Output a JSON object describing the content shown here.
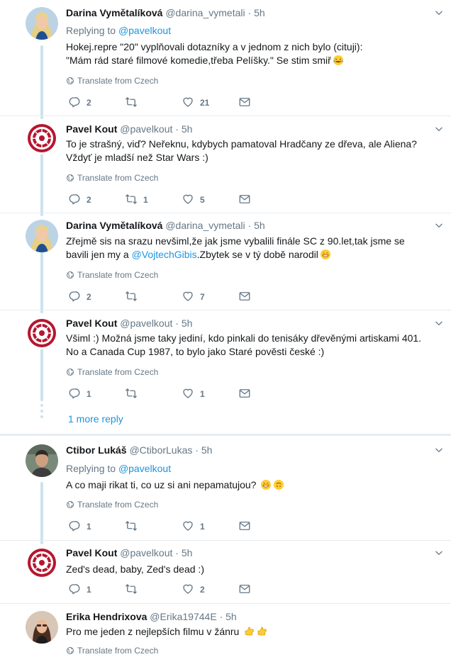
{
  "colors": {
    "link": "#1b95e0",
    "muted": "#657786",
    "thread": "#cde1ee",
    "kout_red": "#b5172f"
  },
  "tweets": [
    {
      "name": "Darina Vymětalíková",
      "handle": "@darina_vymetali",
      "dot": "·",
      "time": "5h",
      "reply_prefix": "Replying to ",
      "reply_to": "@pavelkout",
      "line1": "Hokej.repre \"20\" vyplňovali dotazníky a v jednom z nich bylo (cituji):",
      "line2": "\"Mám rád staré filmové komedie,třeba Pelíšky.\" Se stim smiř",
      "translate": "Translate from Czech",
      "replies": "2",
      "retweets": "",
      "likes": "21"
    },
    {
      "name": "Pavel Kout",
      "handle": "@pavelkout",
      "dot": "·",
      "time": "5h",
      "line1": "To je strašný, viď? Neřeknu, kdybych pamatoval Hradčany ze dřeva, ale Aliena?",
      "line2": "Vždyť je mladší než Star Wars :)",
      "translate": "Translate from Czech",
      "replies": "2",
      "retweets": "1",
      "likes": "5"
    },
    {
      "name": "Darina Vymětalíková",
      "handle": "@darina_vymetali",
      "dot": "·",
      "time": "5h",
      "line1": "Zřejmě sis na srazu nevšiml,že jak jsme vybalili finále SC z 90.let,tak jsme se",
      "line2_pre": "bavili jen my a ",
      "line2_mention": "@VojtechGibis",
      "line2_post": ".Zbytek se v tý době narodil",
      "translate": "Translate from Czech",
      "replies": "2",
      "retweets": "",
      "likes": "7"
    },
    {
      "name": "Pavel Kout",
      "handle": "@pavelkout",
      "dot": "·",
      "time": "5h",
      "line1": "Všiml :) Možná jsme taky jediní, kdo pinkali do tenisáky dřevěnými artiskami 401.",
      "line2": "No a Canada Cup 1987, to bylo jako Staré pověsti české :)",
      "translate": "Translate from Czech",
      "replies": "1",
      "retweets": "",
      "likes": "1"
    },
    {
      "name": "Ctibor Lukáš",
      "handle": "@CtiborLukas",
      "dot": "·",
      "time": "5h",
      "reply_prefix": "Replying to ",
      "reply_to": "@pavelkout",
      "line1": "A co maji rikat ti, co uz si ani nepamatujou?",
      "translate": "Translate from Czech",
      "replies": "1",
      "retweets": "",
      "likes": "1"
    },
    {
      "name": "Pavel Kout",
      "handle": "@pavelkout",
      "dot": "·",
      "time": "5h",
      "line1": "Zed's dead, baby, Zed's dead :)",
      "replies": "1",
      "retweets": "",
      "likes": "2"
    },
    {
      "name": "Erika Hendrixova",
      "handle": "@Erika19744E",
      "dot": "·",
      "time": "5h",
      "line1": "Pro me jeden  z nejlepších filmu v žánru",
      "translate": "Translate from Czech"
    }
  ],
  "more_reply": "1 more reply"
}
